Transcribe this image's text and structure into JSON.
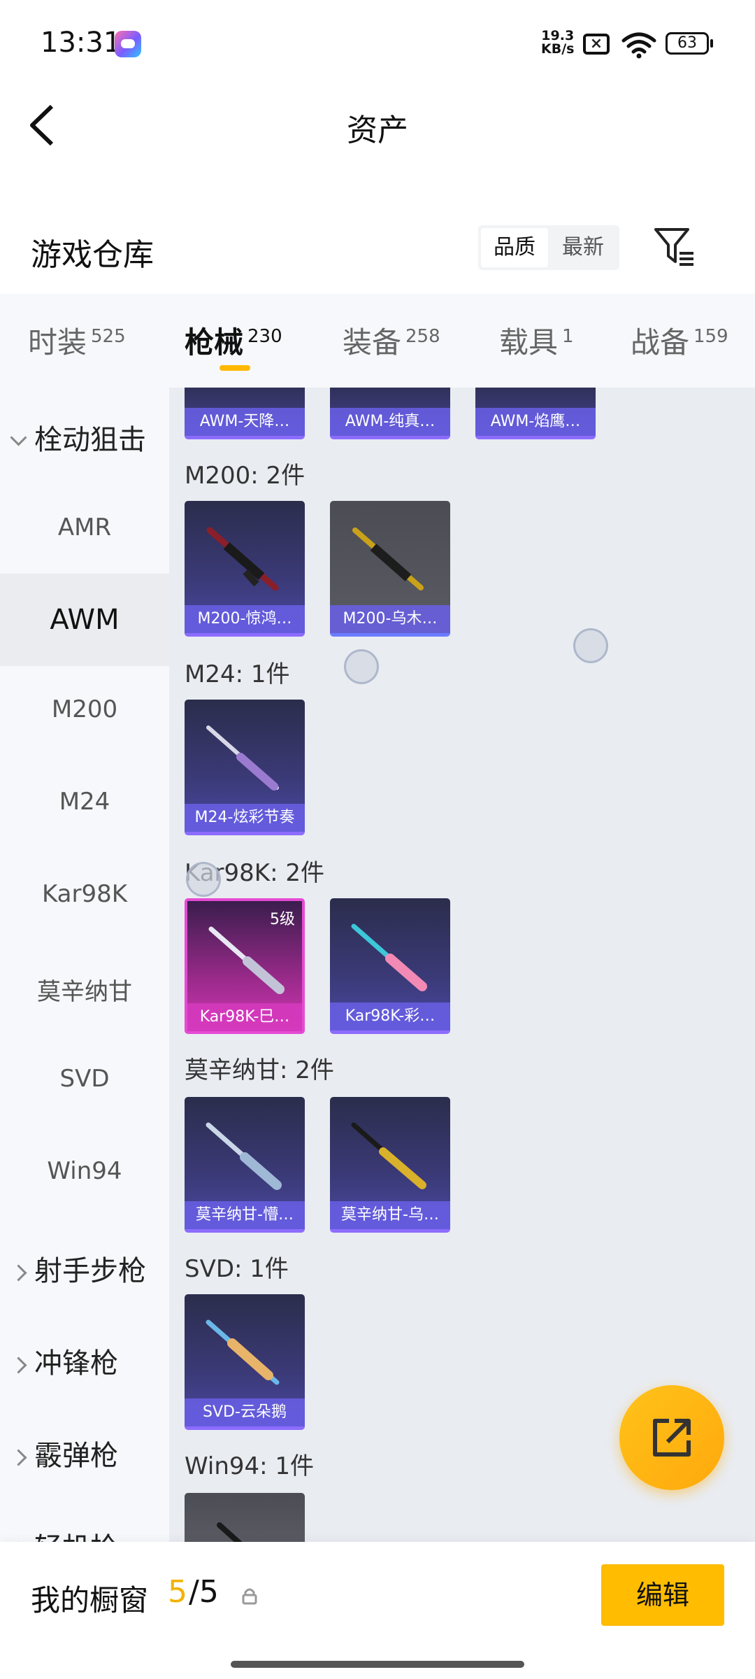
{
  "status_bar": {
    "time": "13:31",
    "net_speed_value": "19.3",
    "net_speed_unit": "KB/s",
    "battery": "63"
  },
  "header": {
    "title": "资产",
    "back_icon": "chevron-left-icon"
  },
  "warehouse": {
    "title": "游戏仓库",
    "sort_quality": "品质",
    "sort_newest": "最新",
    "filter_icon": "filter-icon"
  },
  "tabs": [
    {
      "label": "时装",
      "count": "525"
    },
    {
      "label": "枪械",
      "count": "230",
      "active": true
    },
    {
      "label": "装备",
      "count": "258"
    },
    {
      "label": "载具",
      "count": "1"
    },
    {
      "label": "战备",
      "count": "159"
    }
  ],
  "sidebar": {
    "group_open": "栓动狙击",
    "items": [
      "AMR",
      "AWM",
      "M200",
      "M24",
      "Kar98K",
      "莫辛纳甘",
      "SVD",
      "Win94"
    ],
    "active_item": "AWM",
    "groups_closed": [
      "射手步枪",
      "冲锋枪",
      "霰弹枪",
      "轻机枪"
    ]
  },
  "content": {
    "top_partial_cards": [
      "AWM-天降…",
      "AWM-纯真…",
      "AWM-焰鹰…"
    ],
    "groups": [
      {
        "label": "M200: 2件",
        "items": [
          "M200-惊鸿…",
          "M200-乌木…"
        ]
      },
      {
        "label": "M24: 1件",
        "items": [
          "M24-炫彩节奏"
        ]
      },
      {
        "label": "Kar98K: 2件",
        "items": [
          "Kar98K-巳…",
          "Kar98K-彩…"
        ],
        "level": "5级"
      },
      {
        "label": "莫辛纳甘: 2件",
        "items": [
          "莫辛纳甘-懵…",
          "莫辛纳甘-乌…"
        ]
      },
      {
        "label": "SVD: 1件",
        "items": [
          "SVD-云朵鹅"
        ]
      },
      {
        "label": "Win94: 1件",
        "items": [
          ""
        ]
      }
    ]
  },
  "fab": {
    "icon": "share-icon"
  },
  "bottom_bar": {
    "showcase_label": "我的橱窗",
    "showcase_current": "5",
    "showcase_total": "/5",
    "edit_label": "编辑"
  },
  "colors": {
    "accent": "#ffbc00",
    "card_purple": "#3b3a78",
    "card_pink": "#cf37b4"
  }
}
